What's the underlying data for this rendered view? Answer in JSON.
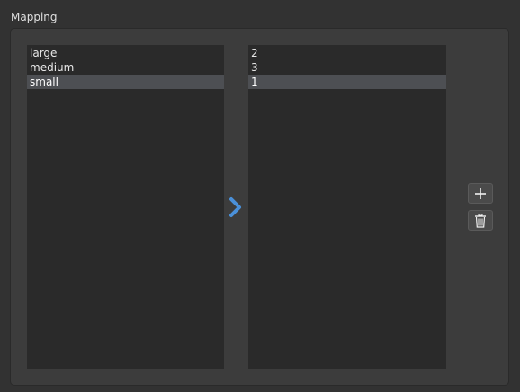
{
  "group": {
    "title": "Mapping"
  },
  "source_list": {
    "items": [
      {
        "label": "large",
        "selected": false
      },
      {
        "label": "medium",
        "selected": false
      },
      {
        "label": "small",
        "selected": true
      }
    ]
  },
  "target_list": {
    "items": [
      {
        "label": "2",
        "selected": false
      },
      {
        "label": "3",
        "selected": false
      },
      {
        "label": "1",
        "selected": true
      }
    ]
  },
  "icons": {
    "arrow": "chevron-right-icon",
    "add": "plus-icon",
    "delete": "trash-icon"
  },
  "colors": {
    "accent_arrow": "#4a90d9",
    "selection": "#4d4f53",
    "list_bg": "#2a2a2a",
    "panel_bg": "#3c3c3c",
    "window_bg": "#323232"
  }
}
